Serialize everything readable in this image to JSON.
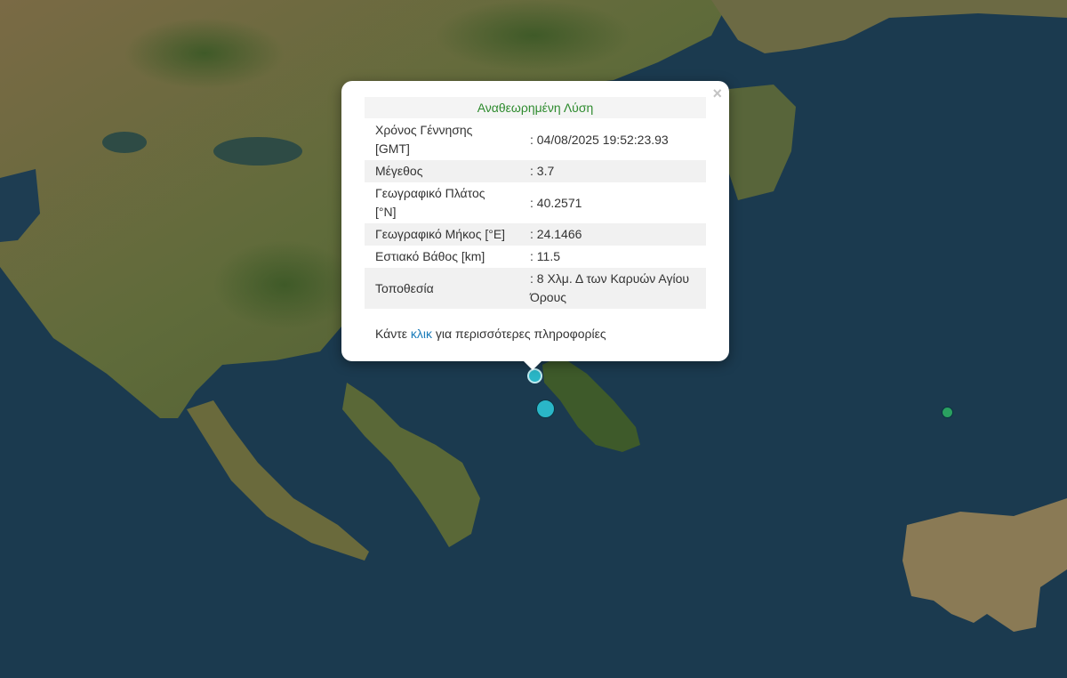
{
  "popup": {
    "title": "Αναθεωρημένη Λύση",
    "close_icon": "close-icon",
    "rows": [
      {
        "label": "Χρόνος Γέννησης [GMT]",
        "value": ": 04/08/2025 19:52:23.93"
      },
      {
        "label": "Μέγεθος",
        "value": ": 3.7"
      },
      {
        "label": "Γεωγραφικό Πλάτος [°N]",
        "value": ": 40.2571"
      },
      {
        "label": "Γεωγραφικό Μήκος [°E]",
        "value": ": 24.1466"
      },
      {
        "label": "Εστιακό Βάθος [km]",
        "value": ": 11.5"
      },
      {
        "label": "Τοποθεσία",
        "value": ": 8 Χλμ. Δ των Καρυών Αγίου Όρους"
      }
    ],
    "more_before": "Κάντε ",
    "more_link": "κλικ",
    "more_after": " για περισσότερες πληροφορίες"
  },
  "colors": {
    "sea": "#1b3a4f",
    "land": "#6b6a3e",
    "marker_cyan": "#2ab6c7",
    "marker_green": "#2aa060",
    "title_green": "#2e8b2e",
    "link_blue": "#1a7bb9"
  },
  "markers": [
    {
      "name": "earthquake-marker-selected",
      "color": "cyan"
    },
    {
      "name": "earthquake-marker",
      "color": "cyan"
    },
    {
      "name": "earthquake-marker",
      "color": "green"
    }
  ]
}
